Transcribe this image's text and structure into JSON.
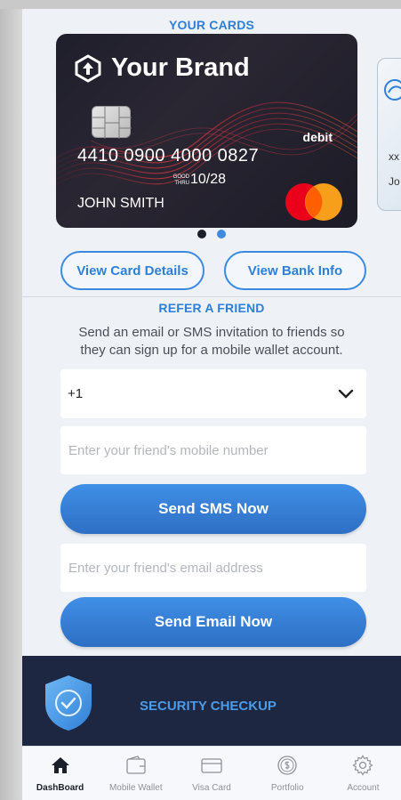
{
  "cards_section": {
    "title": "YOUR CARDS",
    "main_card": {
      "brand": "Your Brand",
      "type": "debit",
      "number": "4410 0900 4000 0827",
      "good_thru": "GOOD THRU",
      "expiry": "10/28",
      "holder": "JOHN SMITH",
      "network_icon": "mastercard-logo"
    },
    "peek_card": {
      "number_fragment": "xx",
      "holder_fragment": "Jo"
    },
    "pagination": {
      "total": 2,
      "active": 1
    }
  },
  "actions": {
    "view_card_details": "View Card Details",
    "view_bank_info": "View Bank Info"
  },
  "refer": {
    "title": "REFER A FRIEND",
    "description_line1": "Send an email or SMS invitation to friends so",
    "description_line2": "they can sign up for a mobile wallet account.",
    "country_code": "+1",
    "mobile_placeholder": "Enter your friend's mobile number",
    "send_sms": "Send SMS Now",
    "email_placeholder": "Enter your friend's email address",
    "send_email": "Send Email Now"
  },
  "security": {
    "title": "SECURITY CHECKUP"
  },
  "tabs": [
    {
      "label": "DashBoard",
      "icon": "home-icon",
      "active": true
    },
    {
      "label": "Mobile Wallet",
      "icon": "wallet-icon",
      "active": false
    },
    {
      "label": "Visa Card",
      "icon": "card-icon",
      "active": false
    },
    {
      "label": "Portfolio",
      "icon": "coin-icon",
      "active": false
    },
    {
      "label": "Account",
      "icon": "gear-icon",
      "active": false
    }
  ],
  "colors": {
    "accent": "#2d7fd8",
    "button_gradient_top": "#3f8fe6",
    "button_gradient_bottom": "#2e6fc4",
    "security_bg": "#1d2741",
    "card_bg": "#1f1e2b"
  }
}
